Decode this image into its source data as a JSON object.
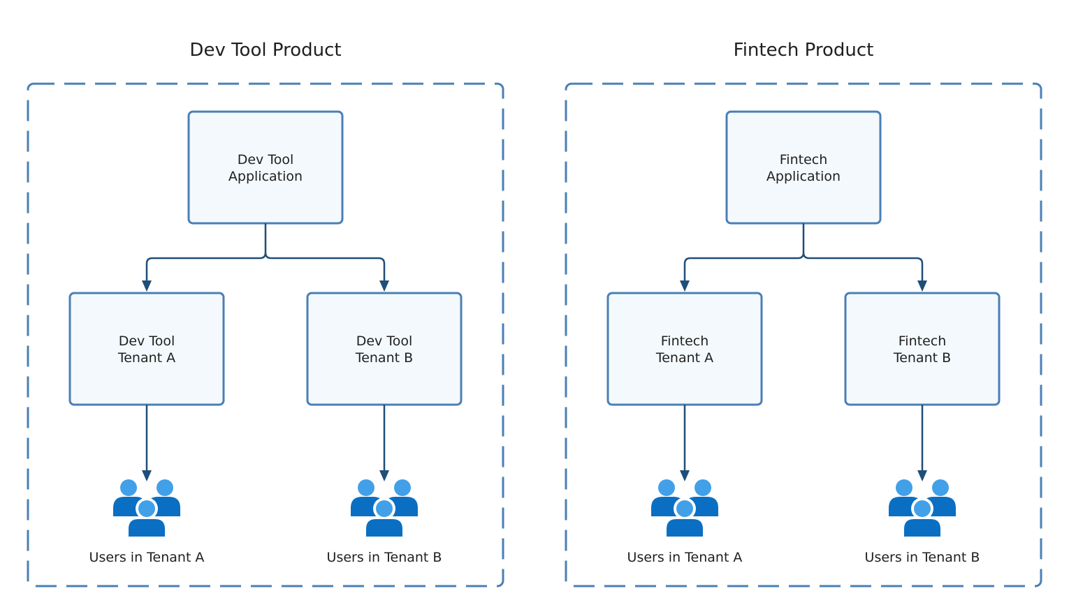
{
  "groups": [
    {
      "title": "Dev Tool Product",
      "application": [
        "Dev Tool",
        "Application"
      ],
      "tenants": [
        {
          "label": [
            "Dev Tool",
            "Tenant A"
          ],
          "users_label": "Users in Tenant A"
        },
        {
          "label": [
            "Dev Tool",
            "Tenant B"
          ],
          "users_label": "Users in Tenant B"
        }
      ]
    },
    {
      "title": "Fintech Product",
      "application": [
        "Fintech",
        "Application"
      ],
      "tenants": [
        {
          "label": [
            "Fintech",
            "Tenant A"
          ],
          "users_label": "Users in Tenant A"
        },
        {
          "label": [
            "Fintech",
            "Tenant B"
          ],
          "users_label": "Users in Tenant B"
        }
      ]
    }
  ],
  "colors": {
    "group_border": "#4a7fb5",
    "box_border": "#4a7fb5",
    "box_fill": "#f4f9fd",
    "connector": "#1f4e79",
    "user_light": "#42a0e8",
    "user_dark": "#0a6fc2"
  }
}
